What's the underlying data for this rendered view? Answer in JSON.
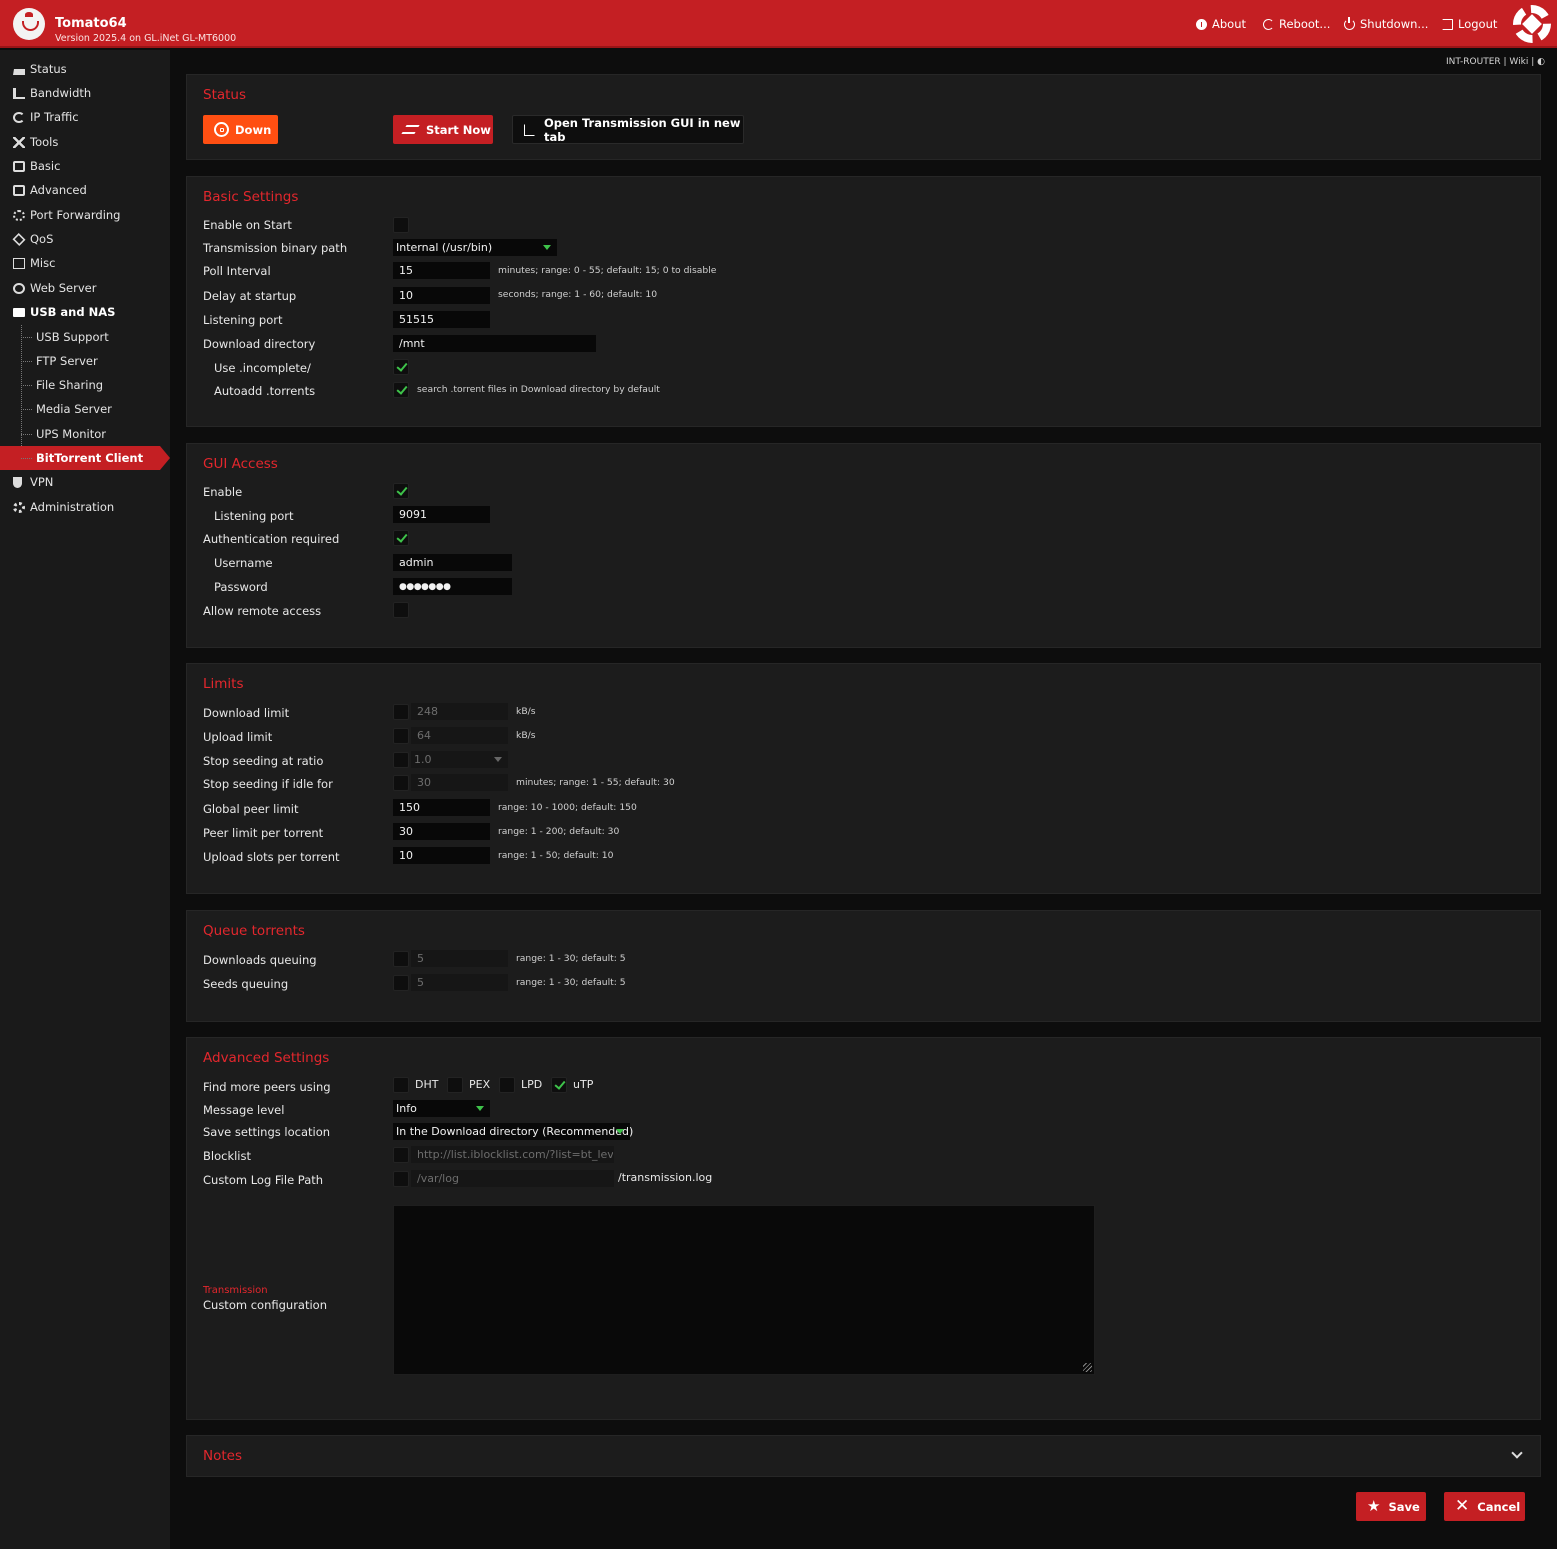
{
  "header": {
    "app_name": "Tomato64",
    "version": "Version 2025.4 on GL.iNet GL-MT6000",
    "nav": {
      "about": "About",
      "reboot": "Reboot...",
      "shutdown": "Shutdown...",
      "logout": "Logout"
    }
  },
  "breadcrumb": "INT-ROUTER | Wiki | ◐",
  "sidebar": {
    "items": {
      "status": "Status",
      "bandwidth": "Bandwidth",
      "ip_traffic": "IP Traffic",
      "tools": "Tools",
      "basic": "Basic",
      "advanced": "Advanced",
      "port_forwarding": "Port Forwarding",
      "qos": "QoS",
      "misc": "Misc",
      "web_server": "Web Server",
      "usb_nas": "USB and NAS",
      "vpn": "VPN",
      "administration": "Administration"
    },
    "usb_sub": {
      "usb_support": "USB Support",
      "ftp_server": "FTP Server",
      "file_sharing": "File Sharing",
      "media_server": "Media Server",
      "ups_monitor": "UPS Monitor",
      "bittorrent": "BitTorrent Client"
    }
  },
  "status": {
    "title": "Status",
    "state_label": "Down",
    "start_label": "Start Now",
    "open_gui_label": "Open Transmission GUI in new tab"
  },
  "basic": {
    "title": "Basic Settings",
    "enable_on_start": {
      "label": "Enable on Start",
      "checked": false
    },
    "binary_path": {
      "label": "Transmission binary path",
      "value": "Internal (/usr/bin)"
    },
    "poll_interval": {
      "label": "Poll Interval",
      "value": "15",
      "hint": "minutes; range: 0 - 55; default: 15; 0 to disable"
    },
    "delay_startup": {
      "label": "Delay at startup",
      "value": "10",
      "hint": "seconds; range: 1 - 60; default: 10"
    },
    "listening_port": {
      "label": "Listening port",
      "value": "51515"
    },
    "download_dir": {
      "label": "Download directory",
      "value": "/mnt"
    },
    "use_incomplete": {
      "label": "Use .incomplete/",
      "checked": true
    },
    "autoadd": {
      "label": "Autoadd .torrents",
      "checked": true,
      "hint": "search .torrent files in Download directory by default"
    }
  },
  "gui": {
    "title": "GUI Access",
    "enable": {
      "label": "Enable",
      "checked": true
    },
    "port": {
      "label": "Listening port",
      "value": "9091"
    },
    "auth": {
      "label": "Authentication required",
      "checked": true
    },
    "username": {
      "label": "Username",
      "value": "admin"
    },
    "password": {
      "label": "Password",
      "value": "●●●●●●●"
    },
    "remote": {
      "label": "Allow remote access",
      "checked": false
    }
  },
  "limits": {
    "title": "Limits",
    "download": {
      "label": "Download limit",
      "value": "248",
      "unit": "kB/s"
    },
    "upload": {
      "label": "Upload limit",
      "value": "64",
      "unit": "kB/s"
    },
    "seed_ratio": {
      "label": "Stop seeding at ratio",
      "value": "1.0"
    },
    "seed_idle": {
      "label": "Stop seeding if idle for",
      "value": "30",
      "hint": "minutes; range: 1 - 55; default: 30"
    },
    "global_peer": {
      "label": "Global peer limit",
      "value": "150",
      "hint": "range: 10 - 1000; default: 150"
    },
    "peer_torrent": {
      "label": "Peer limit per torrent",
      "value": "30",
      "hint": "range: 1 - 200; default: 30"
    },
    "upload_slots": {
      "label": "Upload slots per torrent",
      "value": "10",
      "hint": "range: 1 - 50; default: 10"
    }
  },
  "queue": {
    "title": "Queue torrents",
    "downloads": {
      "label": "Downloads queuing",
      "value": "5",
      "hint": "range: 1 - 30; default: 5"
    },
    "seeds": {
      "label": "Seeds queuing",
      "value": "5",
      "hint": "range: 1 - 30; default: 5"
    }
  },
  "advanced": {
    "title": "Advanced Settings",
    "peers": {
      "label": "Find more peers using",
      "dht": "DHT",
      "pex": "PEX",
      "lpd": "LPD",
      "utp": "uTP"
    },
    "message_level": {
      "label": "Message level",
      "value": "Info"
    },
    "save_location": {
      "label": "Save settings location",
      "value": "In the Download directory (Recommended)"
    },
    "blocklist": {
      "label": "Blocklist",
      "placeholder": "http://list.iblocklist.com/?list=bt_leve"
    },
    "log_path": {
      "label": "Custom Log File Path",
      "placeholder": "/var/log",
      "suffix": "/transmission.log"
    },
    "custom_config": {
      "label_top": "Transmission",
      "label": "Custom configuration",
      "value": ""
    }
  },
  "notes": {
    "title": "Notes"
  },
  "actions": {
    "save": "Save",
    "cancel": "Cancel"
  },
  "colors": {
    "accent": "#c41f23",
    "title_red": "#e3272d",
    "check_green": "#3ec34a",
    "status_orange": "#ff4f12"
  }
}
